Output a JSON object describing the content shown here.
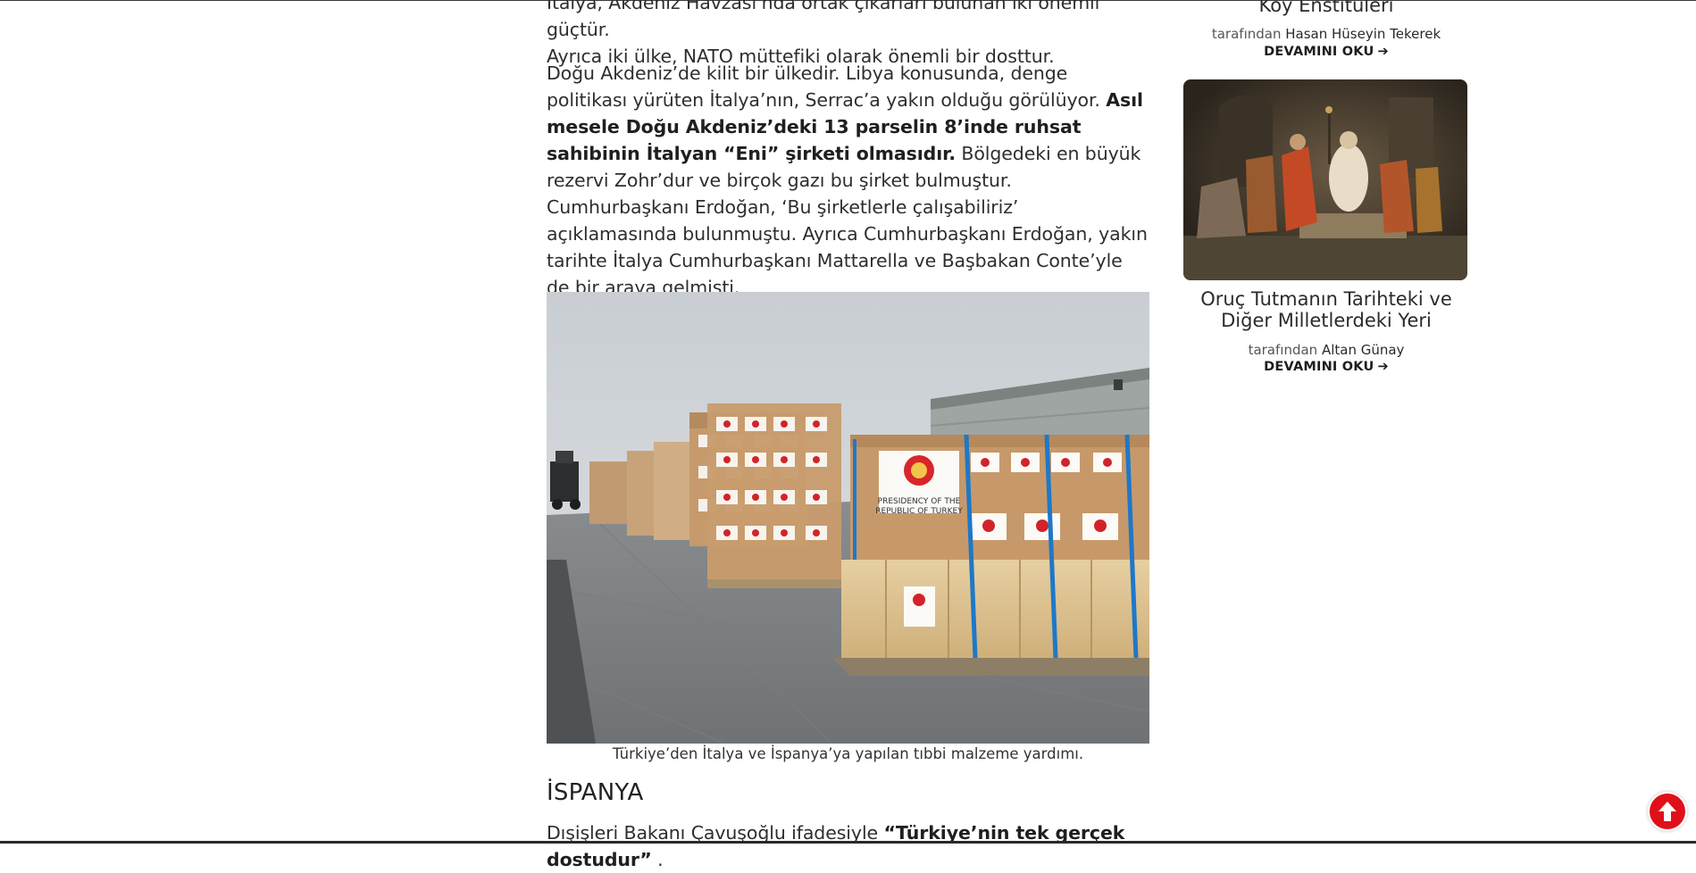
{
  "article": {
    "para1": {
      "line1": "İtalya, Akdeniz Havzası'nda ortak çıkarları bulunan iki önemli güçtür.",
      "line2": "Ayrıca iki ülke, NATO müttefiki olarak önemli bir dosttur."
    },
    "para2": {
      "text_a": "Doğu Akdeniz’de kilit bir ülkedir. Libya konusunda, denge politikası yürüten İtalya’nın, Serrac’a yakın olduğu görülüyor. ",
      "bold": "Asıl mesele Doğu Akdeniz’deki 13 parselin 8’inde ruhsat sahibinin İtalyan “Eni” şirketi olmasıdır.",
      "text_b": " Bölgedeki en büyük rezervi Zohr’dur ve birçok gazı bu şirket bulmuştur. Cumhurbaşkanı Erdoğan, ‘Bu şirketlerle çalışabiliriz’ açıklamasında bulunmuştu. Ayrıca Cumhurbaşkanı Erdoğan, yakın tarihte İtalya Cumhurbaşkanı Mattarella ve Başbakan Conte’yle de bir araya gelmişti."
    },
    "figure": {
      "box_label_line1": "PRESIDENCY OF THE",
      "box_label_line2": "REPUBLIC OF TURKEY",
      "caption": "Türkiye’den İtalya ve İspanya’ya yapılan tıbbi malzeme yardımı."
    },
    "section_heading": "İSPANYA",
    "para3": {
      "text_a": "Dışişleri Bakanı Çavuşoğlu ifadesiyle ",
      "bold": "“Türkiye’nin tek gerçek dostudur”",
      "text_b": " ."
    }
  },
  "sidebar": {
    "post1": {
      "title": "Köy Enstitüleri",
      "by_label": "tarafından",
      "author": "Hasan Hüseyin Tekerek",
      "more": "DEVAMINI OKU"
    },
    "post2": {
      "title": "Oruç Tutmanın Tarihteki ve Diğer Milletlerdeki Yeri",
      "by_label": "tarafından",
      "author": "Altan Günay",
      "more": "DEVAMINI OKU"
    }
  },
  "icons": {
    "read_more": "arrow-right-icon",
    "scroll_top": "arrow-up-circle-icon"
  },
  "colors": {
    "scroll_top_button": "#e0101a",
    "text": "#2e2e2e"
  }
}
